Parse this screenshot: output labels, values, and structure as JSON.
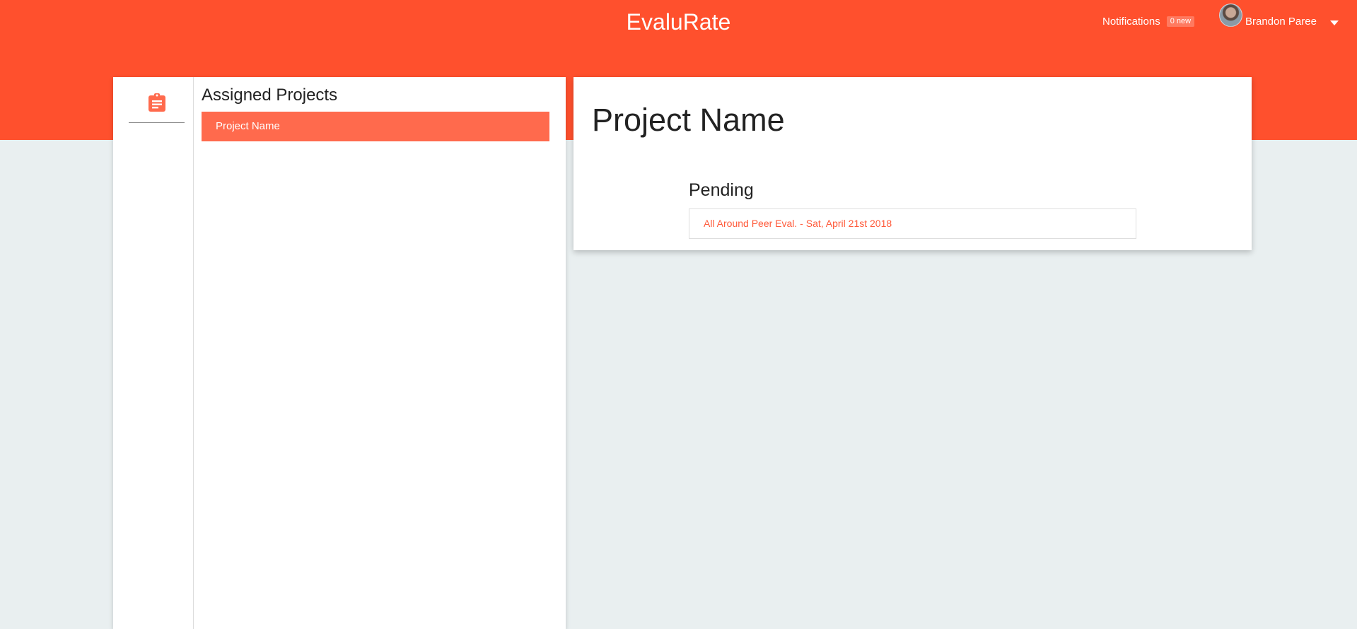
{
  "header": {
    "app_title": "EvaluRate",
    "notifications_label": "Notifications",
    "notifications_badge": "0 new",
    "user_name": "Brandon Paree"
  },
  "sidebar": {
    "rail_icon": "clipboard-icon",
    "heading": "Assigned Projects",
    "projects": [
      {
        "label": "Project Name",
        "selected": true
      }
    ]
  },
  "main": {
    "title": "Project Name",
    "section_heading": "Pending",
    "evaluations": [
      {
        "label": "All Around Peer Eval. - Sat, April 21st 2018"
      }
    ]
  },
  "colors": {
    "brand": "#ff502d",
    "selected_item": "#ff6a4d",
    "link": "#ff5a3a",
    "background": "#e9eff0"
  }
}
